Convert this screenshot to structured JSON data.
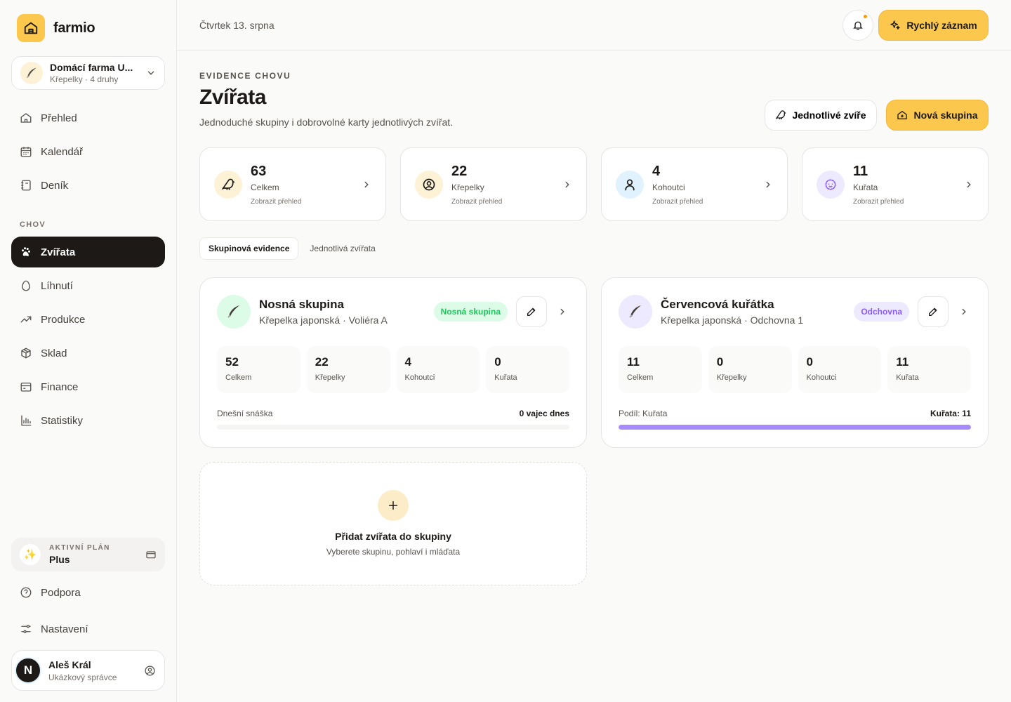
{
  "brand": {
    "name": "farmio"
  },
  "farm": {
    "name": "Domácí farma U...",
    "sub": "Křepelky · 4 druhy"
  },
  "nav": {
    "main": [
      {
        "label": "Přehled",
        "icon": "home-icon"
      },
      {
        "label": "Kalendář",
        "icon": "calendar-icon"
      },
      {
        "label": "Deník",
        "icon": "notebook-icon"
      }
    ],
    "section": "CHOV",
    "chov": [
      {
        "label": "Zvířata",
        "icon": "paw-icon",
        "active": true
      },
      {
        "label": "Líhnutí",
        "icon": "egg-icon"
      },
      {
        "label": "Produkce",
        "icon": "trend-icon"
      },
      {
        "label": "Sklad",
        "icon": "box-icon"
      },
      {
        "label": "Finance",
        "icon": "wallet-icon"
      },
      {
        "label": "Statistiky",
        "icon": "chart-icon"
      }
    ]
  },
  "plan": {
    "label": "AKTIVNÍ PLÁN",
    "value": "Plus"
  },
  "bottom_nav": [
    {
      "label": "Podpora",
      "icon": "help-icon"
    },
    {
      "label": "Nastavení",
      "icon": "settings-icon"
    }
  ],
  "user": {
    "initial": "N",
    "name": "Aleš Král",
    "role": "Ukázkový správce"
  },
  "header": {
    "date": "Čtvrtek 13. srpna",
    "quick_label": "Rychlý záznam"
  },
  "page": {
    "eyebrow": "EVIDENCE CHOVU",
    "title": "Zvířata",
    "subtitle": "Jednoduché skupiny i dobrovolné karty jednotlivých zvířat.",
    "btn_single": "Jednotlivé zvíře",
    "btn_new_group": "Nová skupina"
  },
  "stats": [
    {
      "value": "63",
      "label": "Celkem",
      "link": "Zobrazit přehled",
      "icon": "bird-icon",
      "bg": "#fdf1d6"
    },
    {
      "value": "22",
      "label": "Křepelky",
      "link": "Zobrazit přehled",
      "icon": "female-icon",
      "bg": "#fdf1d6"
    },
    {
      "value": "4",
      "label": "Kohoutci",
      "link": "Zobrazit přehled",
      "icon": "male-icon",
      "bg": "#e0f2fe"
    },
    {
      "value": "11",
      "label": "Kuřata",
      "link": "Zobrazit přehled",
      "icon": "chick-icon",
      "bg": "#ede9fe"
    }
  ],
  "tabs": [
    {
      "label": "Skupinová evidence",
      "active": true
    },
    {
      "label": "Jednotlivá zvířata",
      "active": false
    }
  ],
  "groups": [
    {
      "title": "Nosná skupina",
      "sub": "Křepelka japonská · Voliéra A",
      "badge": "Nosná skupina",
      "badge_bg": "#dcfce7",
      "badge_color": "#22c55e",
      "icon_bg": "#dcfce7",
      "metrics": [
        {
          "value": "52",
          "label": "Celkem"
        },
        {
          "value": "22",
          "label": "Křepelky"
        },
        {
          "value": "4",
          "label": "Kohoutci"
        },
        {
          "value": "0",
          "label": "Kuřata"
        }
      ],
      "foot_label": "Dnešní snáška",
      "foot_value": "0 vajec dnes",
      "progress": 0
    },
    {
      "title": "Červencová kuřátka",
      "sub": "Křepelka japonská · Odchovna 1",
      "badge": "Odchovna",
      "badge_bg": "#ede9fe",
      "badge_color": "#8b5cf6",
      "icon_bg": "#ede9fe",
      "metrics": [
        {
          "value": "11",
          "label": "Celkem"
        },
        {
          "value": "0",
          "label": "Křepelky"
        },
        {
          "value": "0",
          "label": "Kohoutci"
        },
        {
          "value": "11",
          "label": "Kuřata"
        }
      ],
      "foot_label": "Podíl: Kuřata",
      "foot_value": "Kuřata: 11",
      "progress": 1
    }
  ],
  "add_card": {
    "title": "Přidat zvířata do skupiny",
    "sub": "Vyberete skupinu, pohlaví i mláďata"
  },
  "colors": {
    "accent": "#fbc84d",
    "dark": "#1c1917"
  }
}
